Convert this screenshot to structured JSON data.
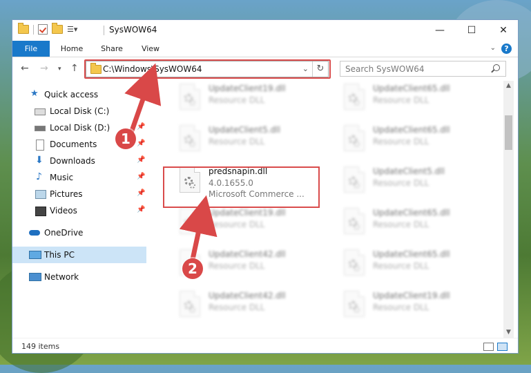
{
  "window": {
    "title": "SysWOW64"
  },
  "ribbon": {
    "tabs": [
      {
        "label": "File"
      },
      {
        "label": "Home"
      },
      {
        "label": "Share"
      },
      {
        "label": "View"
      }
    ],
    "help": "?"
  },
  "address": {
    "path": "C:\\Windows\\SysWOW64",
    "refresh": "↻"
  },
  "search": {
    "placeholder": "Search SysWOW64"
  },
  "sidebar": {
    "items": [
      {
        "label": "Quick access",
        "icon": "star-icon"
      },
      {
        "label": "Local Disk (C:)",
        "icon": "drive-icon"
      },
      {
        "label": "Local Disk (D:)",
        "icon": "drive-icon"
      },
      {
        "label": "Documents",
        "icon": "documents-icon"
      },
      {
        "label": "Downloads",
        "icon": "download-icon"
      },
      {
        "label": "Music",
        "icon": "music-icon"
      },
      {
        "label": "Pictures",
        "icon": "pictures-icon"
      },
      {
        "label": "Videos",
        "icon": "videos-icon"
      },
      {
        "label": "OneDrive",
        "icon": "cloud-icon"
      },
      {
        "label": "This PC",
        "icon": "computer-icon"
      },
      {
        "label": "Network",
        "icon": "network-icon"
      }
    ]
  },
  "files": {
    "left": [
      {
        "name": "UpdateClient19.dll",
        "desc": "Resource DLL"
      },
      {
        "name": "UpdateClient5.dll",
        "desc": "Resource DLL"
      },
      {
        "name": "predsnapin.dll",
        "desc": "4.0.1655.0",
        "company": "Microsoft Commerce ..."
      },
      {
        "name": "UpdateClient19.dll",
        "desc": "Resource DLL"
      },
      {
        "name": "UpdateClient42.dll",
        "desc": "Resource DLL"
      },
      {
        "name": "UpdateClient42.dll",
        "desc": "Resource DLL"
      }
    ],
    "right": [
      {
        "name": "UpdateClient65.dll",
        "desc": "Resource DLL"
      },
      {
        "name": "UpdateClient65.dll",
        "desc": "Resource DLL"
      },
      {
        "name": "UpdateClient5.dll",
        "desc": "Resource DLL"
      },
      {
        "name": "UpdateClient65.dll",
        "desc": "Resource DLL"
      },
      {
        "name": "UpdateClient65.dll",
        "desc": "Resource DLL"
      },
      {
        "name": "UpdateClient19.dll",
        "desc": "Resource DLL"
      }
    ]
  },
  "status": {
    "count": "149 items"
  },
  "annotations": {
    "step1": "1",
    "step2": "2"
  },
  "colors": {
    "accent": "#1979ca",
    "highlight": "#d94b4b",
    "selected": "#cce4f7"
  }
}
